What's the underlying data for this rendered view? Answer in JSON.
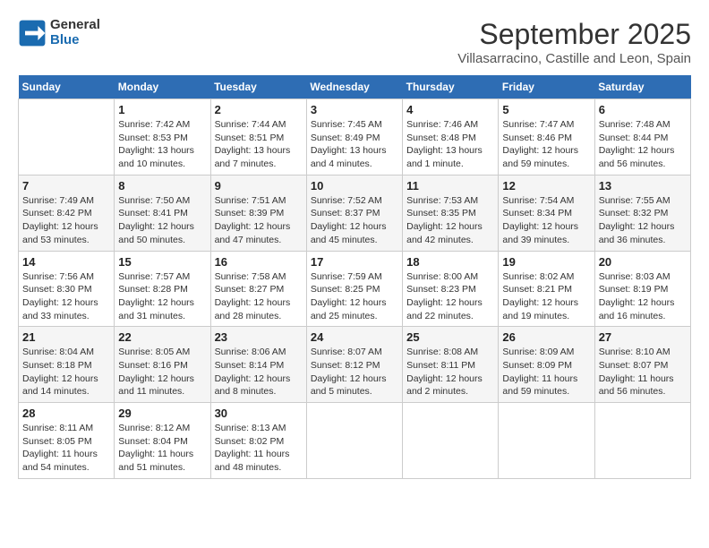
{
  "header": {
    "logo_line1": "General",
    "logo_line2": "Blue",
    "month": "September 2025",
    "location": "Villasarracino, Castille and Leon, Spain"
  },
  "days_of_week": [
    "Sunday",
    "Monday",
    "Tuesday",
    "Wednesday",
    "Thursday",
    "Friday",
    "Saturday"
  ],
  "weeks": [
    [
      {
        "day": null
      },
      {
        "day": 1,
        "sunrise": "7:42 AM",
        "sunset": "8:53 PM",
        "daylight": "13 hours and 10 minutes."
      },
      {
        "day": 2,
        "sunrise": "7:44 AM",
        "sunset": "8:51 PM",
        "daylight": "13 hours and 7 minutes."
      },
      {
        "day": 3,
        "sunrise": "7:45 AM",
        "sunset": "8:49 PM",
        "daylight": "13 hours and 4 minutes."
      },
      {
        "day": 4,
        "sunrise": "7:46 AM",
        "sunset": "8:48 PM",
        "daylight": "13 hours and 1 minute."
      },
      {
        "day": 5,
        "sunrise": "7:47 AM",
        "sunset": "8:46 PM",
        "daylight": "12 hours and 59 minutes."
      },
      {
        "day": 6,
        "sunrise": "7:48 AM",
        "sunset": "8:44 PM",
        "daylight": "12 hours and 56 minutes."
      }
    ],
    [
      {
        "day": 7,
        "sunrise": "7:49 AM",
        "sunset": "8:42 PM",
        "daylight": "12 hours and 53 minutes."
      },
      {
        "day": 8,
        "sunrise": "7:50 AM",
        "sunset": "8:41 PM",
        "daylight": "12 hours and 50 minutes."
      },
      {
        "day": 9,
        "sunrise": "7:51 AM",
        "sunset": "8:39 PM",
        "daylight": "12 hours and 47 minutes."
      },
      {
        "day": 10,
        "sunrise": "7:52 AM",
        "sunset": "8:37 PM",
        "daylight": "12 hours and 45 minutes."
      },
      {
        "day": 11,
        "sunrise": "7:53 AM",
        "sunset": "8:35 PM",
        "daylight": "12 hours and 42 minutes."
      },
      {
        "day": 12,
        "sunrise": "7:54 AM",
        "sunset": "8:34 PM",
        "daylight": "12 hours and 39 minutes."
      },
      {
        "day": 13,
        "sunrise": "7:55 AM",
        "sunset": "8:32 PM",
        "daylight": "12 hours and 36 minutes."
      }
    ],
    [
      {
        "day": 14,
        "sunrise": "7:56 AM",
        "sunset": "8:30 PM",
        "daylight": "12 hours and 33 minutes."
      },
      {
        "day": 15,
        "sunrise": "7:57 AM",
        "sunset": "8:28 PM",
        "daylight": "12 hours and 31 minutes."
      },
      {
        "day": 16,
        "sunrise": "7:58 AM",
        "sunset": "8:27 PM",
        "daylight": "12 hours and 28 minutes."
      },
      {
        "day": 17,
        "sunrise": "7:59 AM",
        "sunset": "8:25 PM",
        "daylight": "12 hours and 25 minutes."
      },
      {
        "day": 18,
        "sunrise": "8:00 AM",
        "sunset": "8:23 PM",
        "daylight": "12 hours and 22 minutes."
      },
      {
        "day": 19,
        "sunrise": "8:02 AM",
        "sunset": "8:21 PM",
        "daylight": "12 hours and 19 minutes."
      },
      {
        "day": 20,
        "sunrise": "8:03 AM",
        "sunset": "8:19 PM",
        "daylight": "12 hours and 16 minutes."
      }
    ],
    [
      {
        "day": 21,
        "sunrise": "8:04 AM",
        "sunset": "8:18 PM",
        "daylight": "12 hours and 14 minutes."
      },
      {
        "day": 22,
        "sunrise": "8:05 AM",
        "sunset": "8:16 PM",
        "daylight": "12 hours and 11 minutes."
      },
      {
        "day": 23,
        "sunrise": "8:06 AM",
        "sunset": "8:14 PM",
        "daylight": "12 hours and 8 minutes."
      },
      {
        "day": 24,
        "sunrise": "8:07 AM",
        "sunset": "8:12 PM",
        "daylight": "12 hours and 5 minutes."
      },
      {
        "day": 25,
        "sunrise": "8:08 AM",
        "sunset": "8:11 PM",
        "daylight": "12 hours and 2 minutes."
      },
      {
        "day": 26,
        "sunrise": "8:09 AM",
        "sunset": "8:09 PM",
        "daylight": "11 hours and 59 minutes."
      },
      {
        "day": 27,
        "sunrise": "8:10 AM",
        "sunset": "8:07 PM",
        "daylight": "11 hours and 56 minutes."
      }
    ],
    [
      {
        "day": 28,
        "sunrise": "8:11 AM",
        "sunset": "8:05 PM",
        "daylight": "11 hours and 54 minutes."
      },
      {
        "day": 29,
        "sunrise": "8:12 AM",
        "sunset": "8:04 PM",
        "daylight": "11 hours and 51 minutes."
      },
      {
        "day": 30,
        "sunrise": "8:13 AM",
        "sunset": "8:02 PM",
        "daylight": "11 hours and 48 minutes."
      },
      {
        "day": null
      },
      {
        "day": null
      },
      {
        "day": null
      },
      {
        "day": null
      }
    ]
  ]
}
